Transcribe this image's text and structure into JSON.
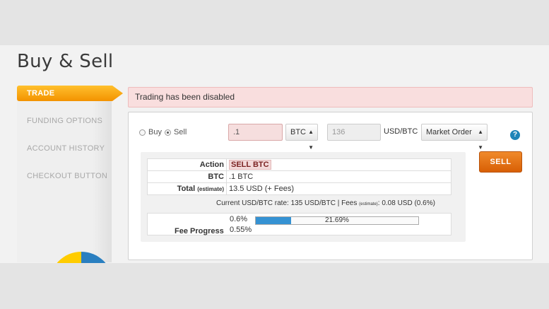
{
  "header": {
    "title": "Buy & Sell"
  },
  "sidebar": {
    "items": [
      {
        "label": "TRADE",
        "active": true
      },
      {
        "label": "FUNDING OPTIONS",
        "active": false
      },
      {
        "label": "ACCOUNT HISTORY",
        "active": false
      },
      {
        "label": "CHECKOUT BUTTON",
        "active": false
      }
    ]
  },
  "alert": {
    "message": "Trading has been disabled"
  },
  "order": {
    "buy_label": "Buy",
    "sell_label": "Sell",
    "selected_side": "sell",
    "amount": ".1",
    "currency": "BTC",
    "price_placeholder": "136",
    "price_unit": "USD/BTC",
    "order_type": "Market Order",
    "help_icon": "question-mark-icon",
    "help_glyph": "?",
    "submit_label": "SELL"
  },
  "summary": {
    "rows": [
      {
        "key": "Action",
        "value": "SELL BTC",
        "highlight": true
      },
      {
        "key": "BTC",
        "value": ".1 BTC"
      },
      {
        "key": "Total",
        "key_suffix": "(estimate)",
        "value": "13.5 USD (+ Fees)"
      }
    ],
    "rate_prefix": "Current USD/BTC rate: 135 USD/BTC | Fees ",
    "rate_small": "(estimate)",
    "rate_suffix": ": 0.08 USD (0.6%)"
  },
  "fee_progress": {
    "label": "Fee Progress",
    "current_fee": "0.6%",
    "next_fee": "0.55%",
    "progress_text": "21.69%",
    "progress_value": 0.2169
  },
  "colors": {
    "accent_orange": "#f39200",
    "sell_button": "#d85f05",
    "alert_bg": "#f9dede",
    "progress_blue": "#3592d3",
    "help_blue": "#1e84b8"
  }
}
